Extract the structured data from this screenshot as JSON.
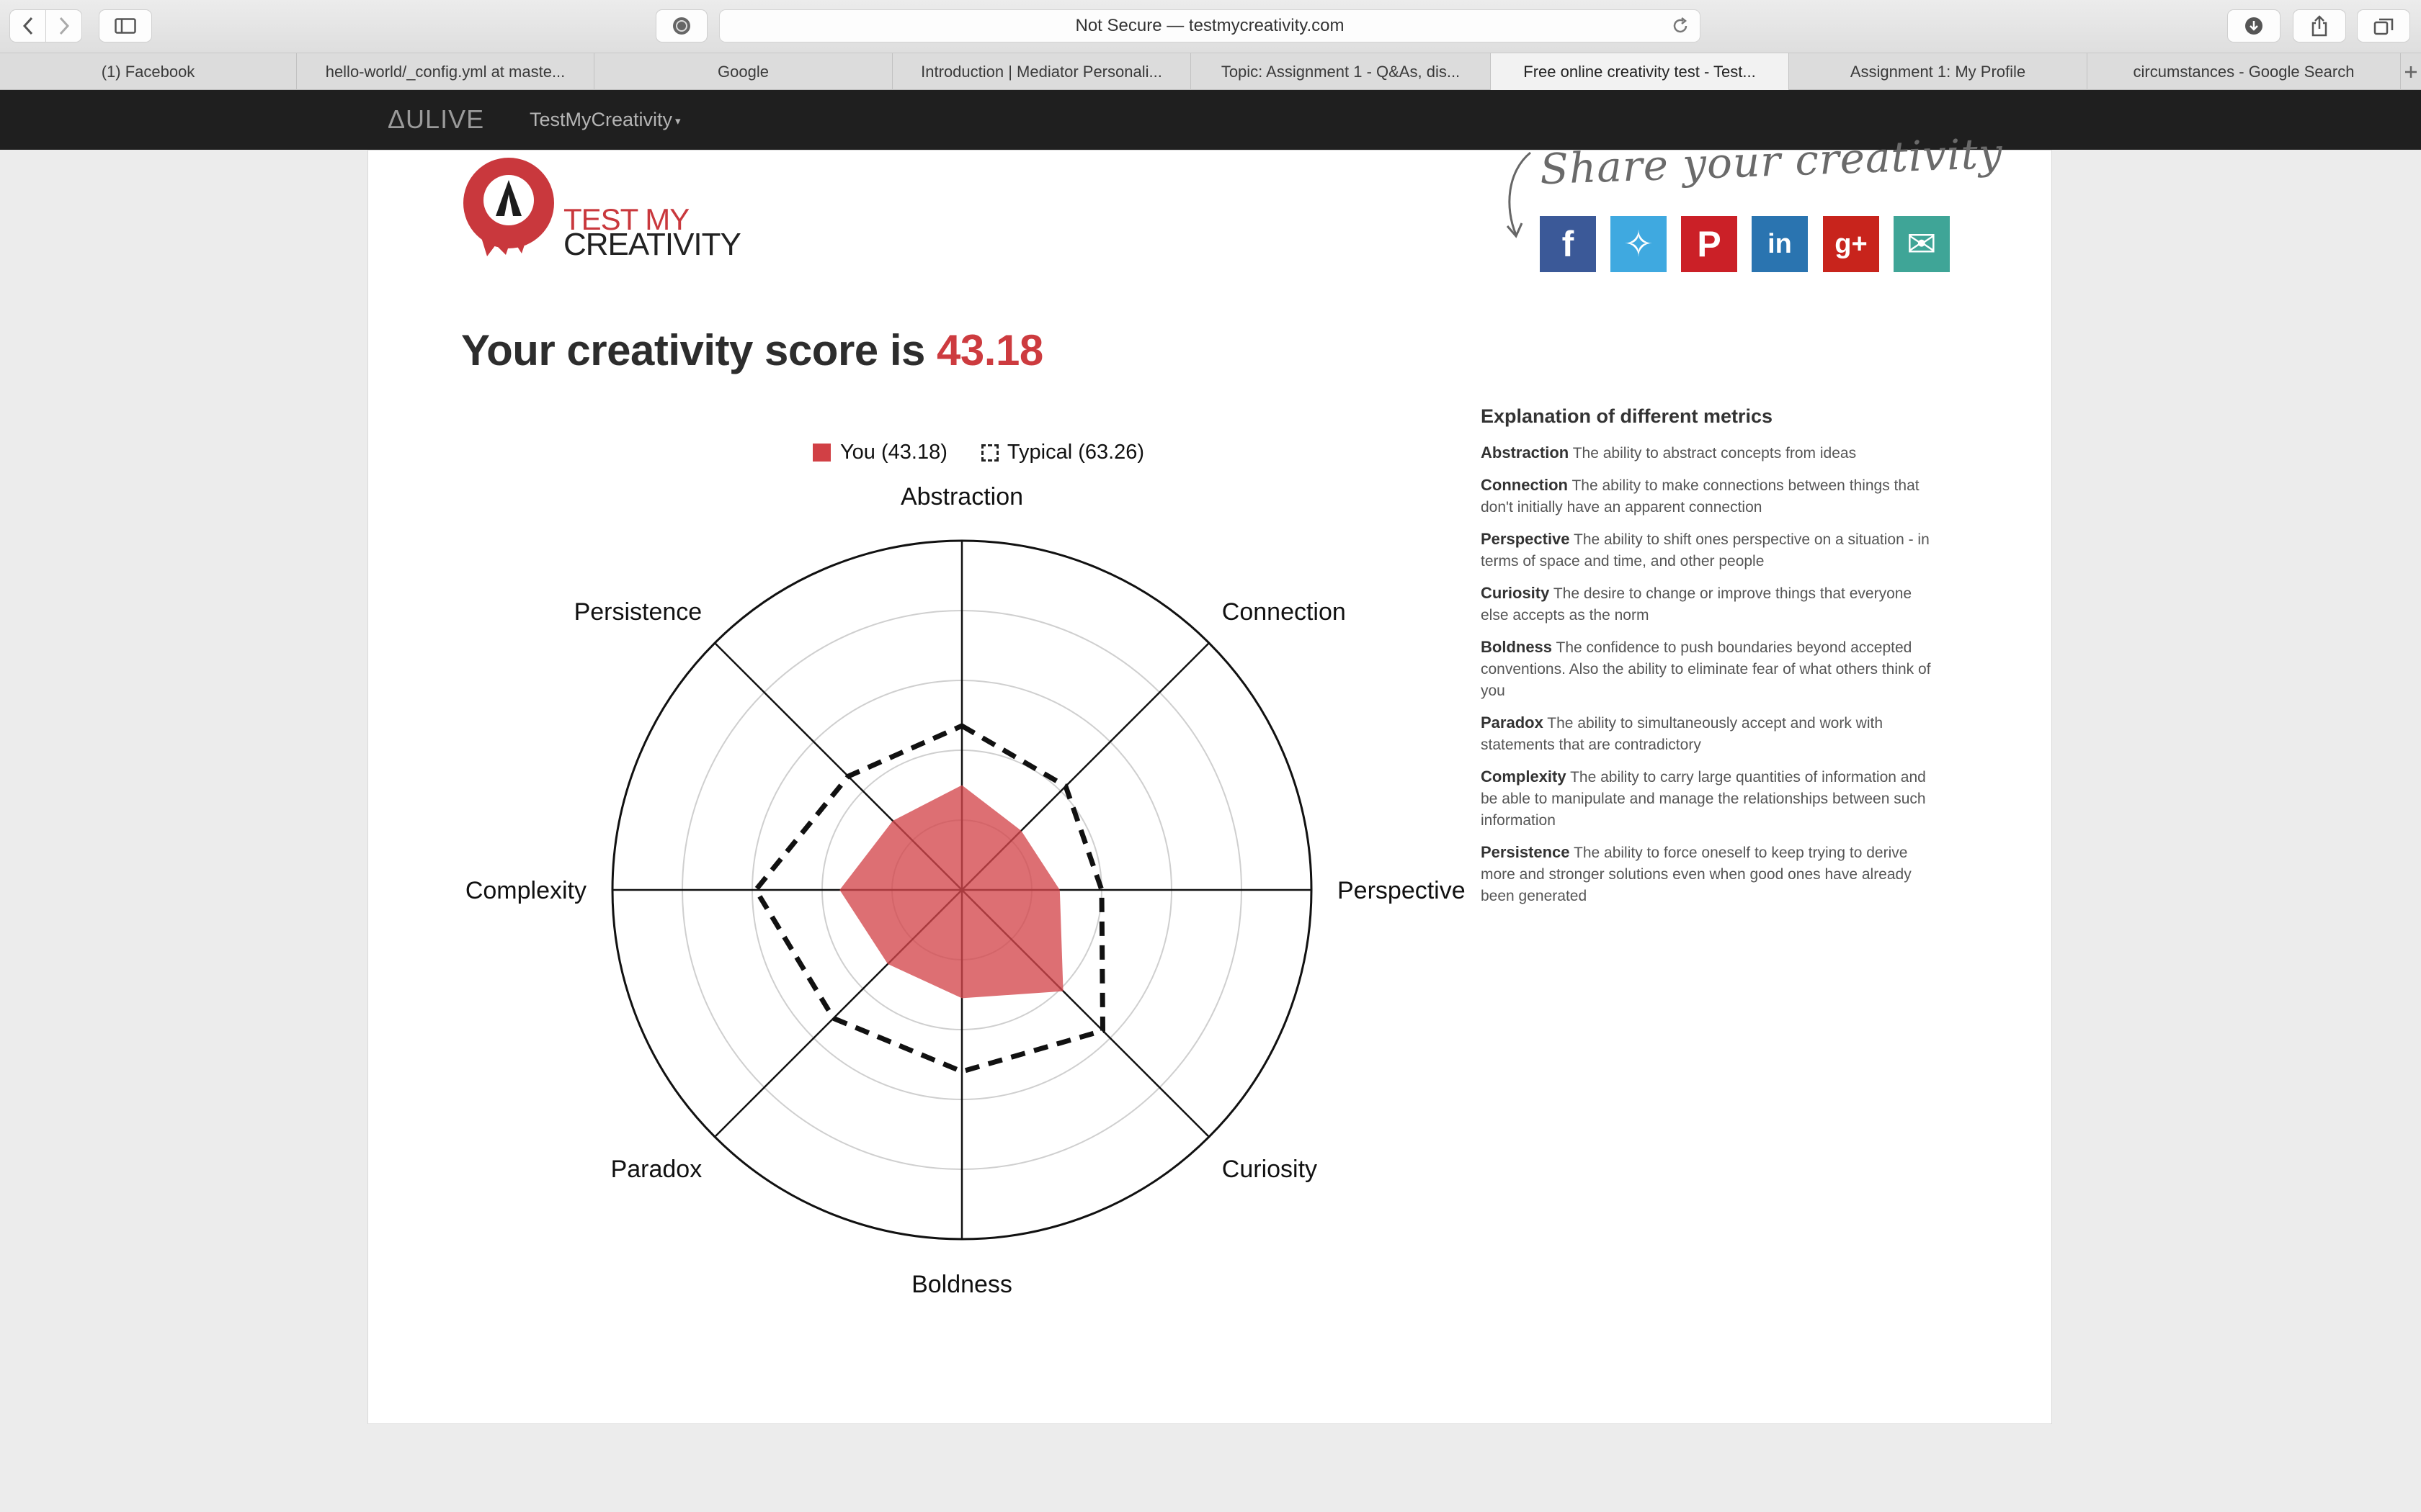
{
  "browser": {
    "address": "Not Secure — testmycreativity.com",
    "tabs": [
      {
        "title": "(1) Facebook"
      },
      {
        "title": "hello-world/_config.yml at maste..."
      },
      {
        "title": "Google"
      },
      {
        "title": "Introduction | Mediator Personali..."
      },
      {
        "title": "Topic: Assignment 1 - Q&As, dis..."
      },
      {
        "title": "Free online creativity test - Test...",
        "active": true
      },
      {
        "title": "Assignment 1: My Profile"
      },
      {
        "title": "circumstances - Google Search"
      }
    ]
  },
  "site_nav": {
    "brand": "ΔULIVE",
    "menu": "TestMyCreativity"
  },
  "logo": {
    "line1": "TEST MY",
    "line2": "CREATIVITY"
  },
  "share": {
    "heading": "Share your creativity",
    "networks": [
      {
        "name": "facebook",
        "glyph": "f",
        "color": "#3b5998"
      },
      {
        "name": "twitter",
        "glyph": "✧",
        "color": "#3fa9e0"
      },
      {
        "name": "pinterest",
        "glyph": "P",
        "color": "#cb2027"
      },
      {
        "name": "linkedin",
        "glyph": "in",
        "color": "#2a74b0"
      },
      {
        "name": "googleplus",
        "glyph": "g+",
        "color": "#c8241c"
      },
      {
        "name": "email",
        "glyph": "✉",
        "color": "#3fa597"
      }
    ]
  },
  "score": {
    "prefix": "Your creativity score is ",
    "value": "43.18"
  },
  "legend": {
    "you": "You (43.18)",
    "typical": "Typical (63.26)"
  },
  "colors": {
    "accent": "#cd3b3f",
    "you_fill": "#d4474c"
  },
  "chart_data": {
    "type": "radar",
    "axes": [
      "Abstraction",
      "Connection",
      "Perspective",
      "Curiosity",
      "Boldness",
      "Paradox",
      "Complexity",
      "Persistence"
    ],
    "rlim": [
      0,
      100
    ],
    "series": [
      {
        "name": "You (43.18)",
        "values": [
          30,
          24,
          28,
          41,
          31,
          30,
          35,
          28
        ],
        "style": "filled"
      },
      {
        "name": "Typical (63.26)",
        "values": [
          47,
          42,
          40,
          57,
          52,
          52,
          59,
          46
        ],
        "style": "dashed"
      }
    ]
  },
  "explanation": {
    "title": "Explanation of different metrics",
    "items": [
      {
        "term": "Abstraction",
        "text": "The ability to abstract concepts from ideas"
      },
      {
        "term": "Connection",
        "text": "The ability to make connections between things that don't initially have an apparent connection"
      },
      {
        "term": "Perspective",
        "text": "The ability to shift ones perspective on a situation - in terms of space and time, and other people"
      },
      {
        "term": "Curiosity",
        "text": "The desire to change or improve things that everyone else accepts as the norm"
      },
      {
        "term": "Boldness",
        "text": "The confidence to push boundaries beyond accepted conventions. Also the ability to eliminate fear of what others think of you"
      },
      {
        "term": "Paradox",
        "text": "The ability to simultaneously accept and work with statements that are contradictory"
      },
      {
        "term": "Complexity",
        "text": "The ability to carry large quantities of information and be able to manipulate and manage the relationships between such information"
      },
      {
        "term": "Persistence",
        "text": "The ability to force oneself to keep trying to derive more and stronger solutions even when good ones have already been generated"
      }
    ]
  }
}
